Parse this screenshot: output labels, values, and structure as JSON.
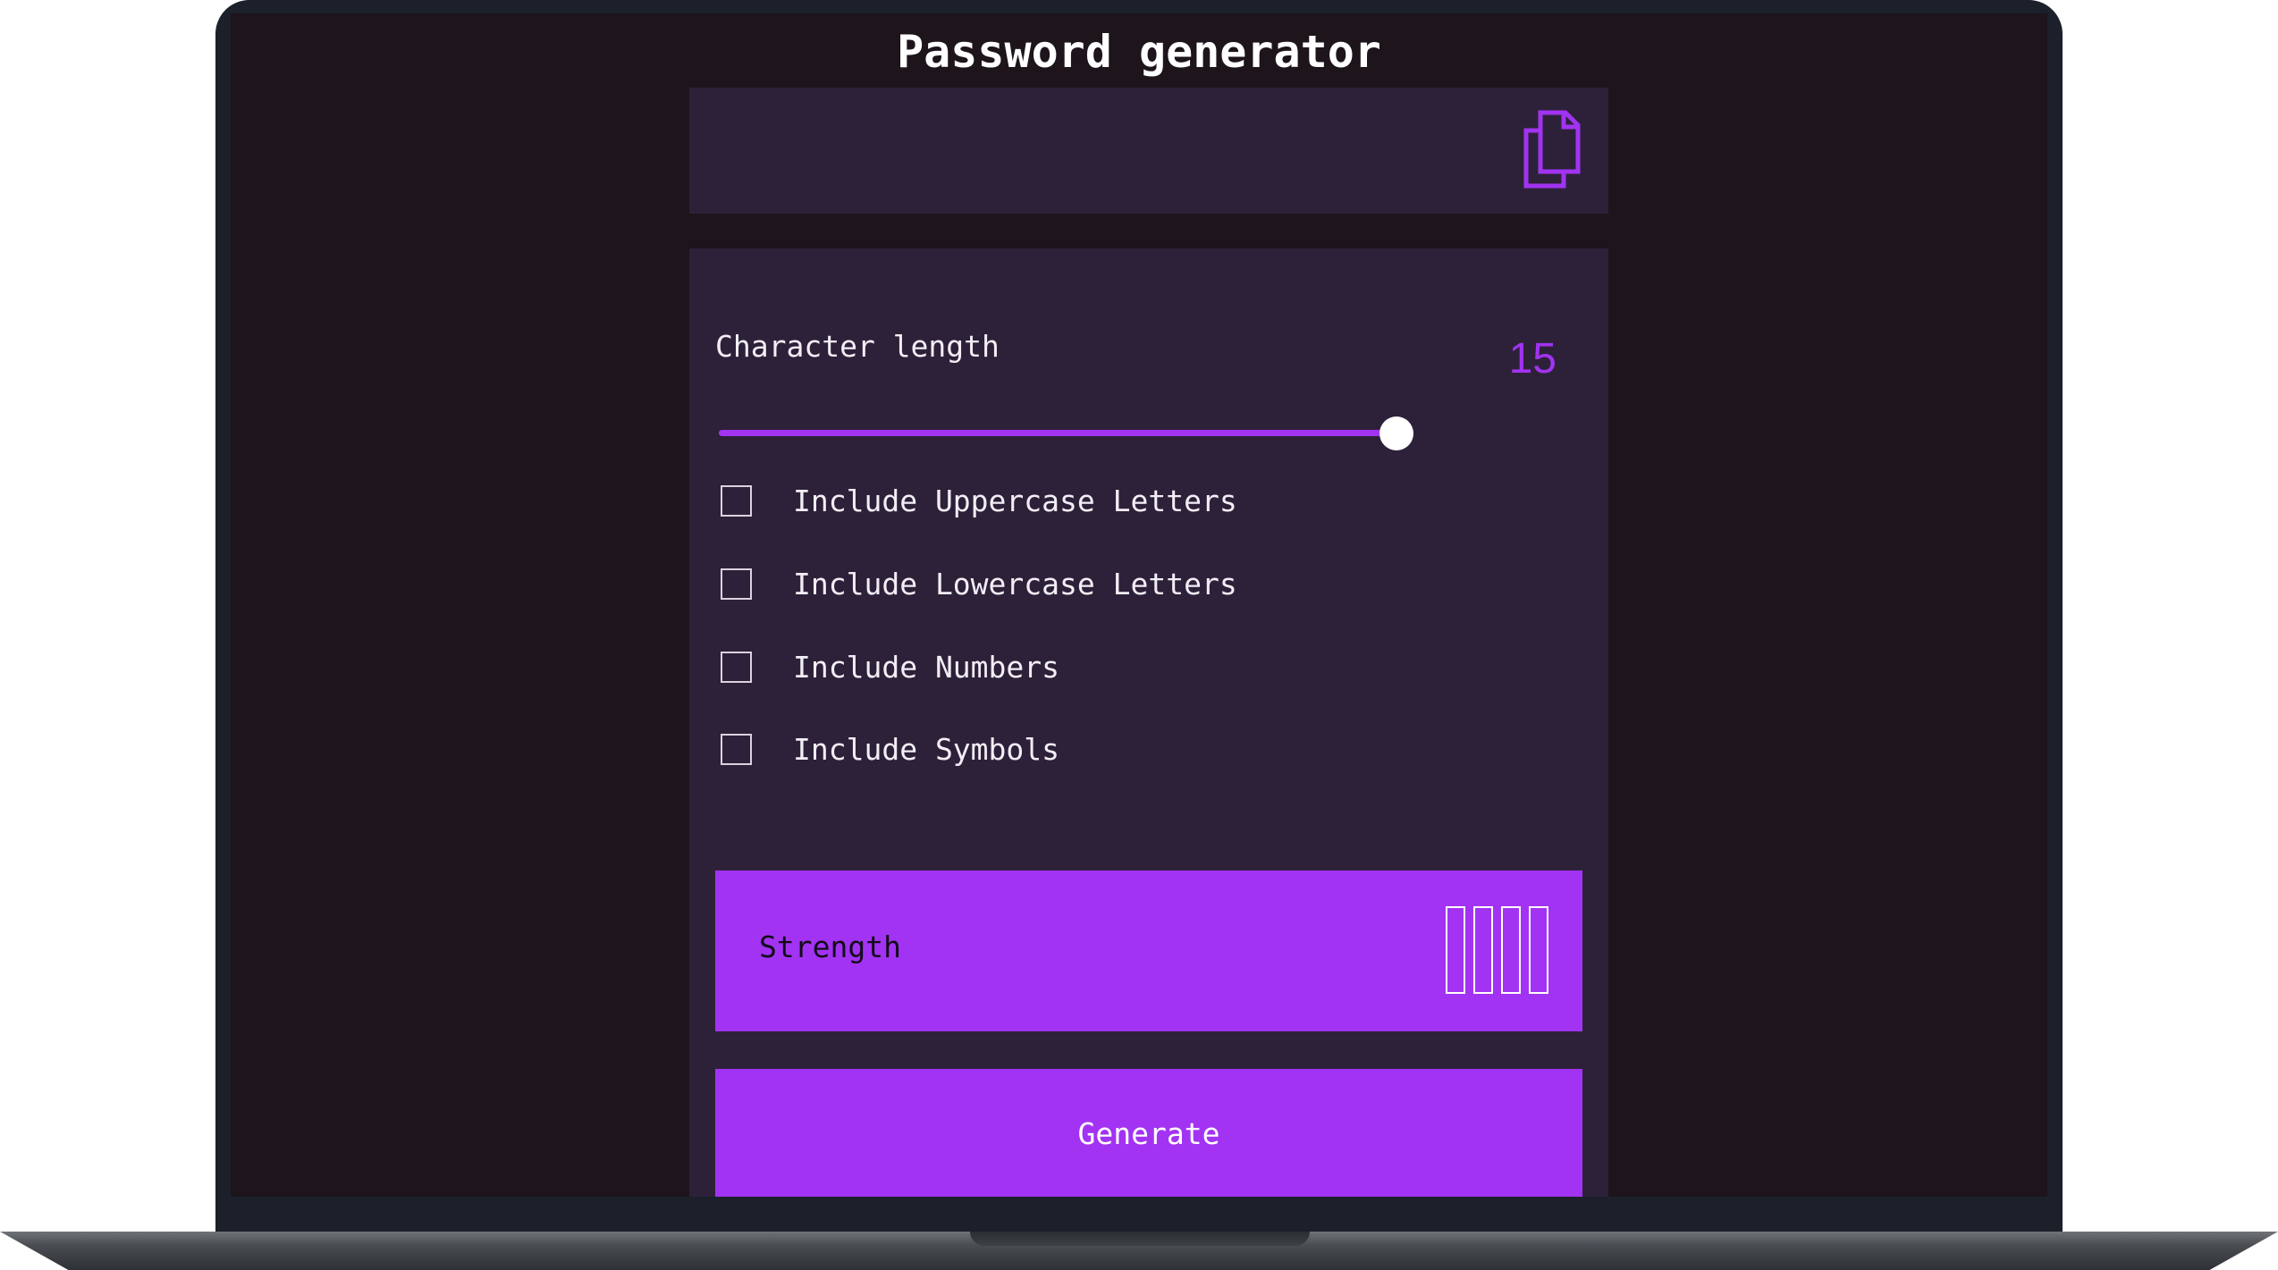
{
  "app": {
    "title": "Password generator"
  },
  "output": {
    "password": "",
    "copy_icon": "copy-icon"
  },
  "length": {
    "label": "Character length",
    "value": "15",
    "slider_fraction": 1.0
  },
  "options": [
    {
      "label": "Include Uppercase Letters",
      "checked": false
    },
    {
      "label": "Include Lowercase Letters",
      "checked": false
    },
    {
      "label": "Include Numbers",
      "checked": false
    },
    {
      "label": "Include Symbols",
      "checked": false
    }
  ],
  "strength": {
    "label": "Strength",
    "bars_total": 4,
    "bars_filled": 0
  },
  "generate": {
    "label": "Generate"
  },
  "colors": {
    "accent": "#a333f3",
    "panel": "#2d2139",
    "background": "#1d151b"
  }
}
